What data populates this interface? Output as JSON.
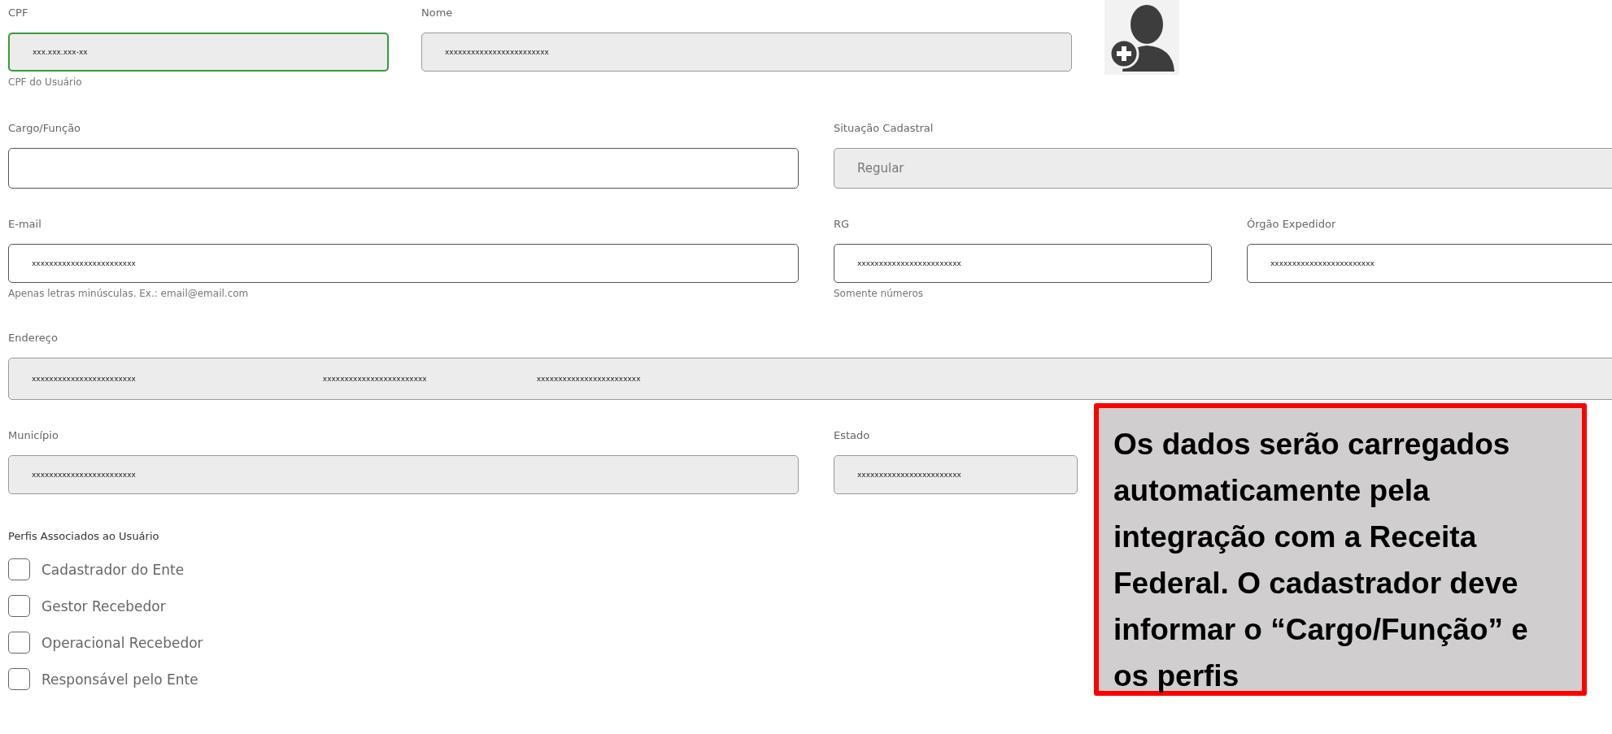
{
  "cpf": {
    "label": "CPF",
    "value": "xxx.xxx.xxx-xx",
    "hint": "CPF do Usuário",
    "readonly": true,
    "focused": true
  },
  "nome": {
    "label": "Nome",
    "value": "xxxxxxxxxxxxxxxxxxxxxxxx",
    "readonly": true,
    "focused": false
  },
  "cargo": {
    "label": "Cargo/Função",
    "readonly": false,
    "focused": false
  },
  "situacao": {
    "label": "Situação Cadastral",
    "value": "Regular",
    "readonly": true,
    "focused": false
  },
  "email": {
    "label": "E-mail",
    "value": "xxxxxxxxxxxxxxxxxxxxxxxx",
    "hint": "Apenas letras minúsculas. Ex.: email@email.com",
    "readonly": false,
    "focused": false
  },
  "rg": {
    "label": "RG",
    "value": "xxxxxxxxxxxxxxxxxxxxxxxx",
    "hint": "Somente números",
    "readonly": false,
    "focused": false
  },
  "orgao": {
    "label": "Órgão Expedidor",
    "value": "xxxxxxxxxxxxxxxxxxxxxxxx",
    "readonly": false,
    "focused": false
  },
  "endereco": {
    "label": "Endereço",
    "values": [
      "xxxxxxxxxxxxxxxxxxxxxxxx",
      "xxxxxxxxxxxxxxxxxxxxxxxx",
      "xxxxxxxxxxxxxxxxxxxxxxxx"
    ],
    "readonly": true,
    "focused": false
  },
  "municipio": {
    "label": "Município",
    "value": "xxxxxxxxxxxxxxxxxxxxxxxx",
    "readonly": true,
    "focused": false
  },
  "estado": {
    "label": "Estado",
    "value": "xxxxxxxxxxxxxxxxxxxxxxxx",
    "readonly": true,
    "focused": false
  },
  "profiles": {
    "title": "Perfis Associados ao Usuário",
    "items": [
      {
        "label": "Cadastrador do Ente",
        "checked": false
      },
      {
        "label": "Gestor Recebedor",
        "checked": false
      },
      {
        "label": "Operacional Recebedor",
        "checked": false
      },
      {
        "label": "Responsável pelo Ente",
        "checked": false
      }
    ]
  },
  "callout": {
    "text": "Os dados serão carregados automaticamente pela integração com a Receita Federal. O cadastrador deve informar o “Cargo/Função” e os perfis"
  }
}
